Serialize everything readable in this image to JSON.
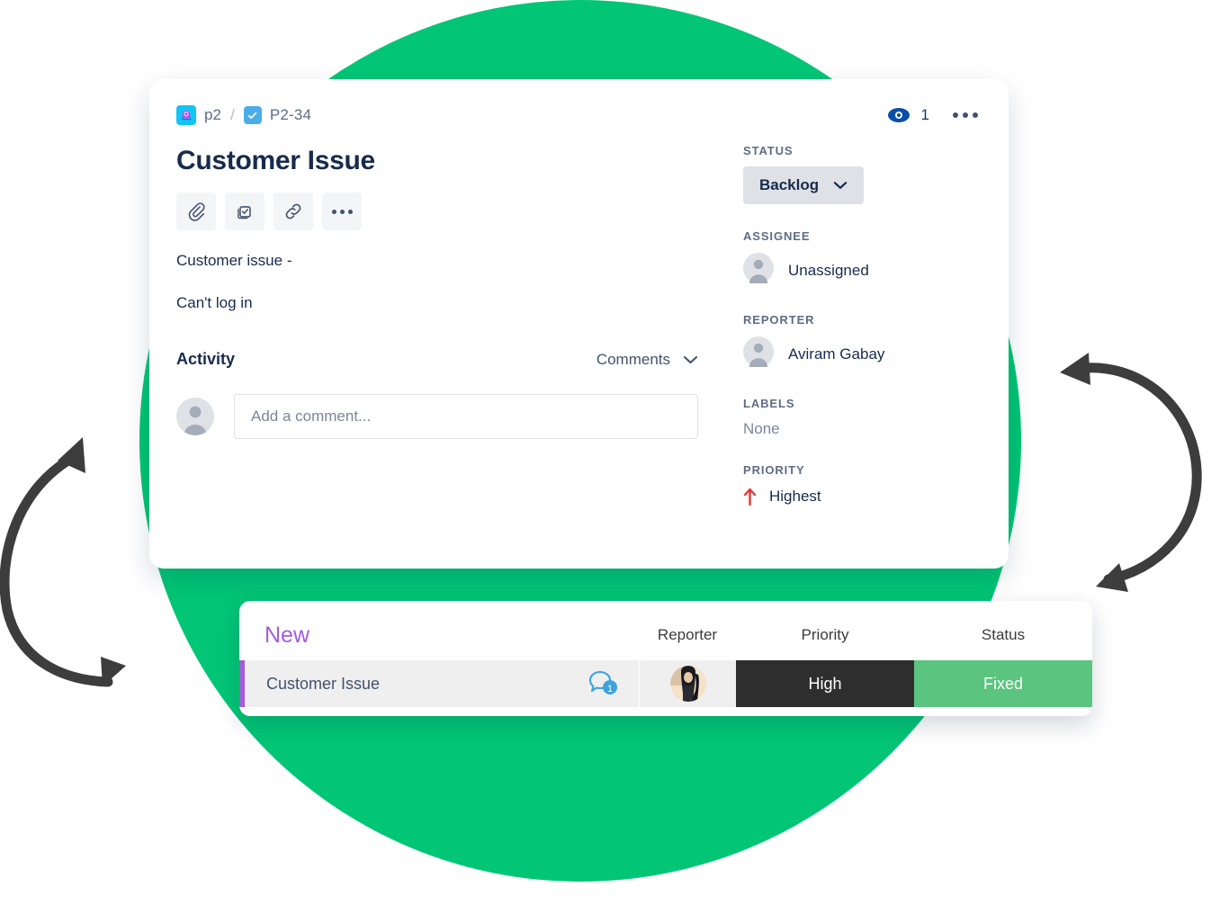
{
  "issue_card": {
    "breadcrumb": {
      "project_key": "p2",
      "separator": "/",
      "issue_key": "P2-34",
      "project_icon": "project-avatar-icon",
      "issue_type_icon": "task-checkbox-icon"
    },
    "watch": {
      "icon": "eye-icon",
      "count": "1"
    },
    "more_menu_icon": "more-horizontal-icon",
    "title": "Customer Issue",
    "actions": [
      {
        "name": "attach-button",
        "icon": "paperclip-icon"
      },
      {
        "name": "add-child-issue-button",
        "icon": "child-issue-icon"
      },
      {
        "name": "link-issue-button",
        "icon": "link-icon"
      },
      {
        "name": "more-actions-button",
        "icon": "more-horizontal-icon"
      }
    ],
    "description_lines": [
      "Customer issue -",
      "Can't log in"
    ],
    "activity": {
      "heading": "Activity",
      "filter_label": "Comments",
      "filter_icon": "chevron-down-icon",
      "comment_placeholder": "Add a comment...",
      "commenter_avatar_icon": "user-avatar-icon"
    },
    "fields": {
      "status": {
        "label": "STATUS",
        "value": "Backlog",
        "chevron_icon": "chevron-down-icon"
      },
      "assignee": {
        "label": "ASSIGNEE",
        "value": "Unassigned",
        "avatar_icon": "user-avatar-icon"
      },
      "reporter": {
        "label": "REPORTER",
        "value": "Aviram Gabay",
        "avatar_icon": "user-avatar-icon"
      },
      "labels": {
        "label": "LABELS",
        "value": "None"
      },
      "priority": {
        "label": "PRIORITY",
        "value": "Highest",
        "icon": "arrow-up-icon",
        "icon_color": "#E03A34"
      }
    }
  },
  "list_card": {
    "group_label": "New",
    "columns": [
      "Reporter",
      "Priority",
      "Status"
    ],
    "rows": [
      {
        "title": "Customer Issue",
        "comment_count": "1",
        "comment_icon": "speech-bubble-icon",
        "reporter_avatar_icon": "person-photo-avatar",
        "priority": "High",
        "status": "Fixed"
      }
    ]
  },
  "decor": {
    "left_arrow_icon": "cycle-arrow-icon",
    "right_arrow_icon": "cycle-arrow-icon",
    "circle_color": "#02C675",
    "accent_purple": "#A35DDB",
    "priority_cell_color": "#2E2E2E",
    "status_cell_color": "#5BC47E"
  }
}
